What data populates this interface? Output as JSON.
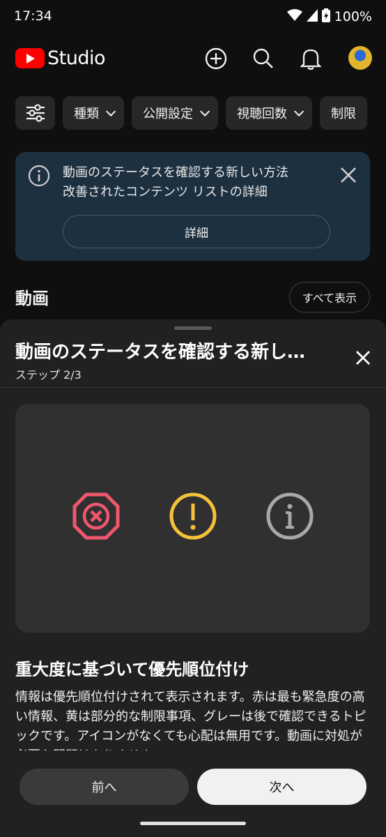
{
  "status_bar": {
    "time": "17:34",
    "battery": "100%"
  },
  "header": {
    "logo_text": "Studio"
  },
  "filters": {
    "chips": [
      {
        "label": "種類"
      },
      {
        "label": "公開設定"
      },
      {
        "label": "視聴回数"
      },
      {
        "label": "制限"
      }
    ]
  },
  "banner": {
    "line1": "動画のステータスを確認する新しい方法",
    "line2": "改善されたコンテンツ リストの詳細",
    "button": "詳細"
  },
  "videos_section": {
    "title": "動画",
    "show_all": "すべて表示"
  },
  "sheet": {
    "title": "動画のステータスを確認する新し…",
    "step": "ステップ 2/3",
    "content_title": "重大度に基づいて優先順位付け",
    "content_body": "情報は優先順位付けされて表示されます。赤は最も緊急度の高い情報、黄は部分的な制限事項、グレーは後で確認できるトピックです。アイコンがなくても心配は無用です。動画に対処が必要な問題はありません。",
    "prev_label": "前へ",
    "next_label": "次へ"
  },
  "colors": {
    "error": "#f0566e",
    "warning": "#f5c13a",
    "info": "#a8a8a8",
    "banner_bg": "#1d3040"
  },
  "icons": [
    "wifi-icon",
    "signal-icon",
    "battery-icon",
    "create-icon",
    "search-icon",
    "notifications-icon",
    "filter-icon",
    "info-icon",
    "close-icon",
    "error-octagon-icon",
    "warning-circle-icon",
    "info-circle-icon"
  ]
}
